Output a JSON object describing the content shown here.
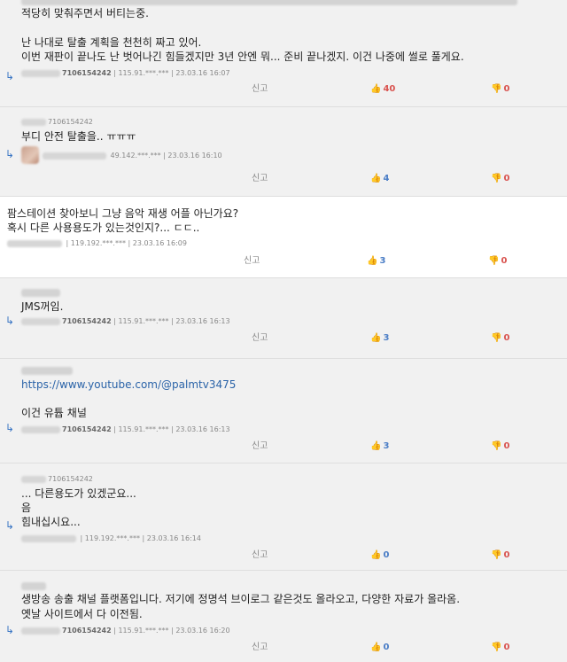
{
  "common": {
    "report": "신고",
    "sep": "|"
  },
  "comments": [
    {
      "lines": [
        "적당히 맞춰주면서 버티는중.",
        "난 나대로 탈출 계획을 천천히 짜고 있어.",
        "이번 재판이 끝나도 난 벗어나긴 힘들겠지만 3년 안엔 뭐... 준비 끝나겠지. 이건 나중에 썰로 풀게요."
      ],
      "nick": "7106154242",
      "ip": "115.91.***.***",
      "date": "23.03.16 16:07",
      "up": "40",
      "down": "0"
    },
    {
      "nick_small": "7106154242",
      "lines": [
        "부디 안전 탈출을.. ㅠㅠㅠ"
      ],
      "ip": "49.142.***.***",
      "date": "23.03.16 16:10",
      "up": "4",
      "down": "0"
    },
    {
      "lines": [
        "팜스테이션 찾아보니 그냥 음악 재생 어플 아닌가요?",
        "혹시 다른 사용용도가 있는것인지?... ㄷㄷ.."
      ],
      "ip": "119.192.***.***",
      "date": "23.03.16 16:09",
      "up": "3",
      "down": "0"
    },
    {
      "lines": [
        "JMS꺼임."
      ],
      "nick": "7106154242",
      "ip": "115.91.***.***",
      "date": "23.03.16 16:13",
      "up": "3",
      "down": "0"
    },
    {
      "link": "https://www.youtube.com/@palmtv3475",
      "lines": [
        "이건 유튭 채널"
      ],
      "nick": "7106154242",
      "ip": "115.91.***.***",
      "date": "23.03.16 16:13",
      "up": "3",
      "down": "0"
    },
    {
      "nick_small": "7106154242",
      "lines": [
        "... 다른용도가 있겠군요...",
        "음",
        "힘내십시요..."
      ],
      "ip": "119.192.***.***",
      "date": "23.03.16 16:14",
      "up": "0",
      "down": "0"
    },
    {
      "lines": [
        "생방송 송출 채널 플랫폼입니다. 저기에 정명석 브이로그 같은것도 올라오고, 다양한 자료가 올라옴.",
        "옛날 사이트에서 다 이전됨."
      ],
      "nick": "7106154242",
      "ip": "115.91.***.***",
      "date": "23.03.16 16:20",
      "up": "0",
      "down": "0"
    }
  ]
}
